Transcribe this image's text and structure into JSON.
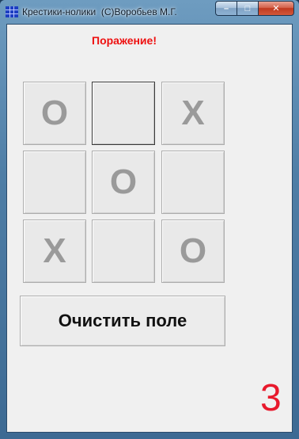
{
  "window": {
    "title": "Крестики-нолики  (С)Воробьев М.Г.",
    "controls": {
      "minimize_label": "–",
      "maximize_label": "□",
      "close_label": "✕"
    }
  },
  "game": {
    "status": "Поражение!",
    "board": [
      [
        "O",
        "",
        "X"
      ],
      [
        "",
        "O",
        ""
      ],
      [
        "X",
        "",
        "O"
      ]
    ],
    "focused_cell": {
      "row": 0,
      "col": 1
    },
    "clear_button_label": "Очистить поле",
    "counter": "3"
  },
  "colors": {
    "status_text": "#ee1111",
    "counter_text": "#e8192c",
    "mark_text": "#9a9a9a",
    "client_background": "#f0f0f0"
  }
}
